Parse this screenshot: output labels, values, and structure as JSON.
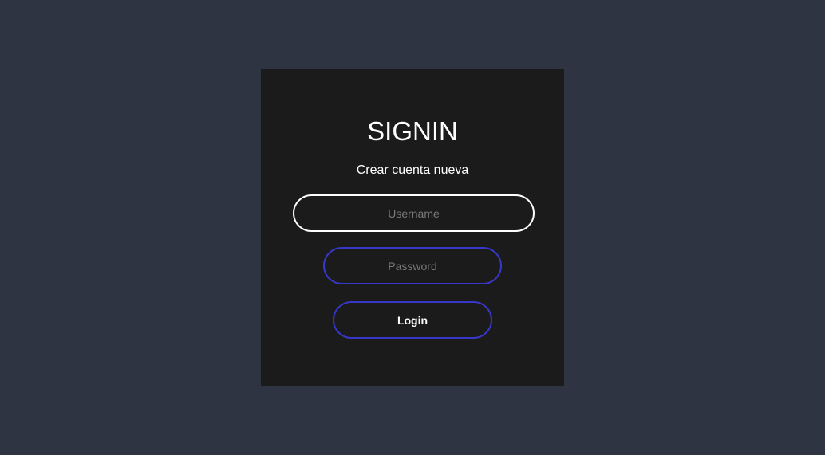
{
  "colors": {
    "page_background": "#2f3443",
    "card_background": "#1b1b1b",
    "accent": "#3737c8",
    "text": "#ffffff",
    "placeholder": "#7a7a7a"
  },
  "signin": {
    "title": "SIGNIN",
    "create_account_link": "Crear cuenta nueva",
    "username": {
      "placeholder": "Username",
      "value": ""
    },
    "password": {
      "placeholder": "Password",
      "value": ""
    },
    "login_label": "Login"
  }
}
